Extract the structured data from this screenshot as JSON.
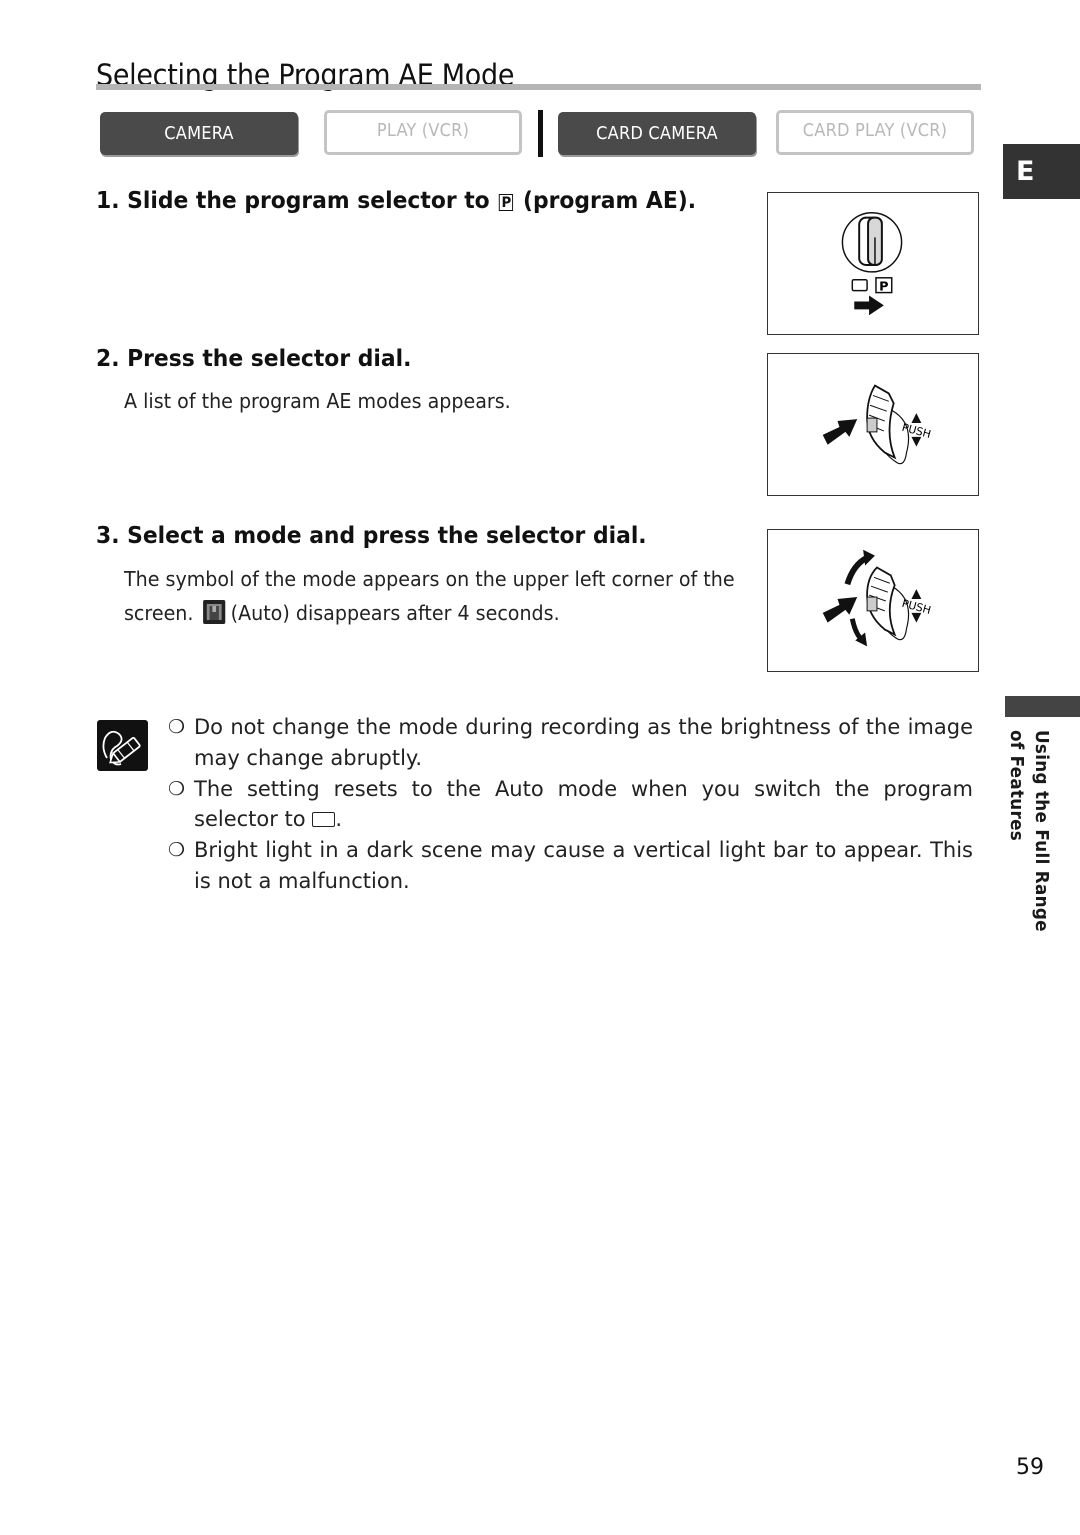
{
  "page": {
    "title": "Selecting the Program AE Mode",
    "page_number": "59",
    "language_tab": "E",
    "section_label_line1": "Using the Full Range",
    "section_label_line2": "of Features"
  },
  "modes": [
    {
      "label": "CAMERA",
      "active": true
    },
    {
      "label": "PLAY (VCR)",
      "active": false
    },
    {
      "label": "CARD CAMERA",
      "active": true
    },
    {
      "label": "CARD PLAY (VCR)",
      "active": false
    }
  ],
  "steps": [
    {
      "number": "1.",
      "title_before": "Slide the program selector to",
      "symbol": "P",
      "title_after": "(program AE).",
      "figure": "program-selector-slide-illustration"
    },
    {
      "number": "2.",
      "title": "Press the selector dial.",
      "body": "A list of the program AE modes appears.",
      "figure": "selector-dial-push-illustration",
      "figure_label": "PUSH"
    },
    {
      "number": "3.",
      "title": "Select a mode and press the selector dial.",
      "body_line1": "The symbol of the mode appears on the upper left corner of the",
      "body_line2_before": "screen.",
      "body_line2_after": "(Auto) disappears after 4 seconds.",
      "figure": "selector-dial-turn-push-illustration",
      "figure_label": "PUSH"
    }
  ],
  "notes": {
    "icon": "pencil-note-icon",
    "bullet": "❍",
    "items": [
      {
        "text": "Do not change the mode during recording as the brightness of the image may change abruptly."
      },
      {
        "text_before": "The setting resets to the Auto mode when you switch the program selector to",
        "text_after": "."
      },
      {
        "text": "Bright light in a dark scene may cause a vertical light bar to appear. This is not a malfunction."
      }
    ]
  }
}
